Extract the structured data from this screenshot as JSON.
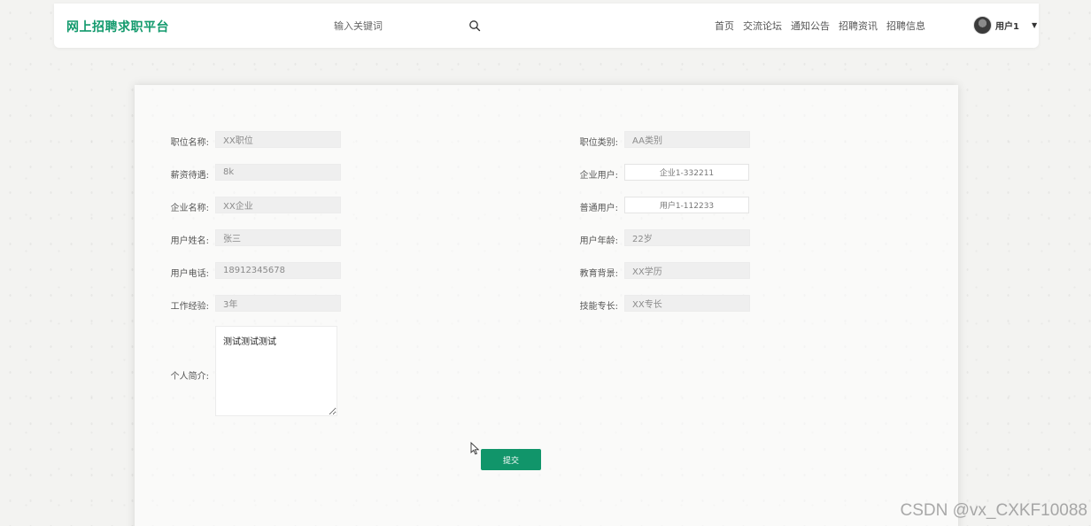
{
  "header": {
    "brand": "网上招聘求职平台",
    "search_placeholder": "输入关键词",
    "nav": [
      "首页",
      "交流论坛",
      "通知公告",
      "招聘资讯",
      "招聘信息"
    ],
    "user_name": "用户1",
    "accent_color": "#139a6d"
  },
  "form": {
    "left": [
      {
        "label": "职位名称:",
        "value": "XX职位"
      },
      {
        "label": "薪资待遇:",
        "value": "8k"
      },
      {
        "label": "企业名称:",
        "value": "XX企业"
      },
      {
        "label": "用户姓名:",
        "value": "张三"
      },
      {
        "label": "用户电话:",
        "value": "18912345678"
      },
      {
        "label": "工作经验:",
        "value": "3年"
      }
    ],
    "right": [
      {
        "label": "职位类别:",
        "value": "AA类别"
      },
      {
        "label": "企业用户:",
        "value": "企业1-332211"
      },
      {
        "label": "普通用户:",
        "value": "用户1-112233"
      },
      {
        "label": "用户年龄:",
        "value": "22岁"
      },
      {
        "label": "教育背景:",
        "value": "XX学历"
      },
      {
        "label": "技能专长:",
        "value": "XX专长"
      }
    ],
    "intro": {
      "label": "个人简介:",
      "value": "测试测试测试"
    },
    "submit_label": "提交"
  },
  "watermark": "CSDN @vx_CXKF10088"
}
